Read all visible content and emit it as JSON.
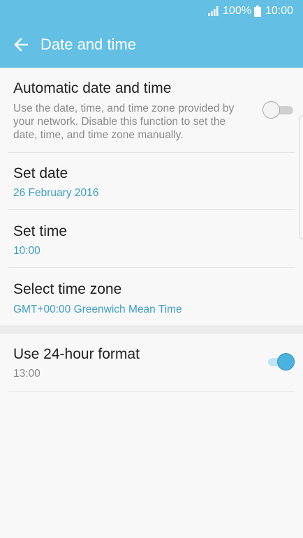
{
  "status_bar": {
    "battery_percent": "100%",
    "time": "10:00"
  },
  "header": {
    "title": "Date and time",
    "back_icon": "arrow-left-icon"
  },
  "settings": {
    "automatic": {
      "title": "Automatic date and time",
      "description": "Use the date, time, and time zone provided by your network. Disable this function to set the date, time, and time zone manually.",
      "enabled": false
    },
    "set_date": {
      "title": "Set date",
      "value": "26 February 2016"
    },
    "set_time": {
      "title": "Set time",
      "value": "10:00"
    },
    "time_zone": {
      "title": "Select time zone",
      "value": "GMT+00:00 Greenwich Mean Time"
    },
    "format_24h": {
      "title": "Use 24-hour format",
      "value": "13:00",
      "enabled": true
    }
  },
  "colors": {
    "accent": "#63bfe4",
    "subtitle_blue": "#3e9fc6",
    "switch_on": "#4bb3e0"
  }
}
